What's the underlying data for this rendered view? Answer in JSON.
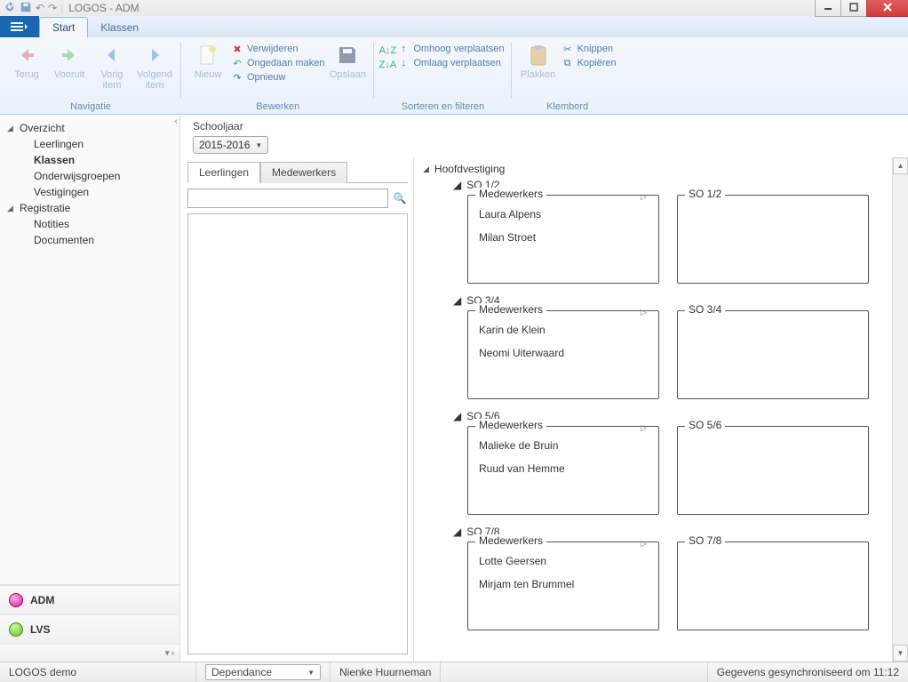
{
  "title": "LOGOS - ADM",
  "tabs": {
    "start": "Start",
    "klassen": "Klassen"
  },
  "ribbon": {
    "navigatie": {
      "label": "Navigatie",
      "terug": "Terug",
      "vooruit": "Vooruit",
      "vorig": "Vorig item",
      "volgend": "Volgend item"
    },
    "bewerken": {
      "label": "Bewerken",
      "nieuw": "Nieuw",
      "verwijderen": "Verwijderen",
      "ongedaan": "Ongedaan maken",
      "opnieuw": "Opnieuw",
      "opslaan": "Opslaan"
    },
    "sorteren": {
      "label": "Sorteren en filteren",
      "omhoog": "Omhoog verplaatsen",
      "omlaag": "Omlaag verplaatsen"
    },
    "klembord": {
      "label": "Klembord",
      "plakken": "Plakken",
      "knippen": "Knippen",
      "kopieren": "Kopiëren"
    }
  },
  "nav": {
    "overzicht": "Overzicht",
    "leerlingen": "Leerlingen",
    "klassen": "Klassen",
    "onderwijsgroepen": "Onderwijsgroepen",
    "vestigingen": "Vestigingen",
    "registratie": "Registratie",
    "notities": "Notities",
    "documenten": "Documenten",
    "adm": "ADM",
    "lvs": "LVS"
  },
  "content": {
    "schooljaar_label": "Schooljaar",
    "schooljaar_value": "2015-2016",
    "tab_leerlingen": "Leerlingen",
    "tab_medewerkers": "Medewerkers",
    "search_placeholder": "",
    "vestiging": "Hoofdvestiging",
    "medewerkers_legend": "Medewerkers",
    "klassen": [
      {
        "name": "SO 1/2",
        "medewerkers": [
          "Laura Alpens",
          "Milan Stroet"
        ]
      },
      {
        "name": "SO 3/4",
        "medewerkers": [
          "Karin de Klein",
          "Neomi Uiterwaard"
        ]
      },
      {
        "name": "SO 5/6",
        "medewerkers": [
          "Malieke de Bruin",
          "Ruud van Hemme"
        ]
      },
      {
        "name": "SO 7/8",
        "medewerkers": [
          "Lotte Geersen",
          "Mirjam ten Brummel"
        ]
      }
    ]
  },
  "status": {
    "product": "LOGOS demo",
    "vestiging": "Dependance",
    "user": "Nienke Huurneman",
    "sync": "Gegevens gesynchroniseerd om 11:12"
  }
}
